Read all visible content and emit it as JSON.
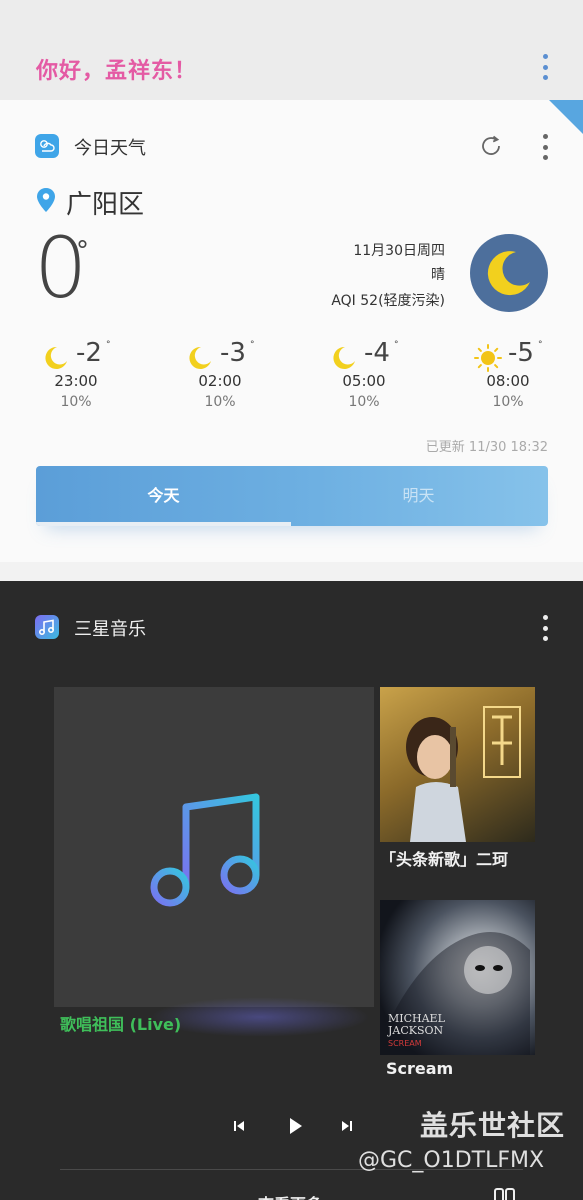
{
  "header": {
    "greeting": "你好，孟祥东！",
    "menu_icon": "more-vert-icon"
  },
  "weather": {
    "app_title": "今日天气",
    "app_icon": "weather-cloud-icon",
    "location": "广阳区",
    "current_temp": "0",
    "degree": "°",
    "date": "11月30日周四",
    "condition": "晴",
    "aqi": "AQI 52(轻度污染)",
    "current_icon": "moon-icon",
    "forecast": [
      {
        "icon": "moon-icon",
        "temp": "-2",
        "time": "23:00",
        "precip": "10%"
      },
      {
        "icon": "moon-icon",
        "temp": "-3",
        "time": "02:00",
        "precip": "10%"
      },
      {
        "icon": "moon-icon",
        "temp": "-4",
        "time": "05:00",
        "precip": "10%"
      },
      {
        "icon": "sun-icon",
        "temp": "-5",
        "time": "08:00",
        "precip": "10%"
      }
    ],
    "updated": "已更新 11/30 18:32",
    "tabs": {
      "today": "今天",
      "tomorrow": "明天"
    },
    "accent_color": "#5b9ed8"
  },
  "music": {
    "app_title": "三星音乐",
    "app_icon": "music-note-icon",
    "main_song": "歌唱祖国 (Live)",
    "side_songs": [
      "「头条新歌」二珂",
      "Scream"
    ],
    "view_more": "查看更多",
    "main_song_color": "#3fbf5a"
  },
  "watermark": {
    "title": "盖乐世社区",
    "handle": "@GC_O1DTLFMX"
  }
}
